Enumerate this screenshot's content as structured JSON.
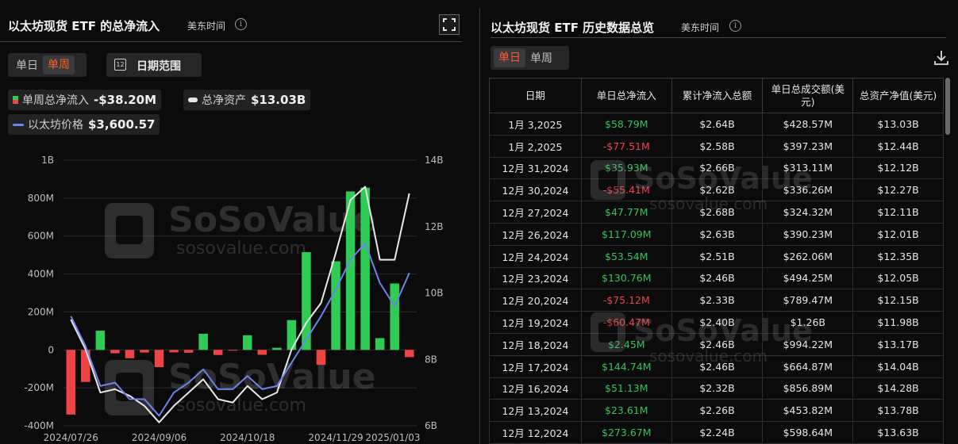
{
  "left_panel": {
    "title": "以太坊现货 ETF 的总净流入",
    "timezone": "美东时间",
    "tabs": [
      "单日",
      "单周"
    ],
    "active_tab": "单周",
    "date_range_label": "日期范围",
    "legend": {
      "net_inflow": {
        "label": "单周总净流入",
        "value": "-$38.20M"
      },
      "total_assets": {
        "label": "总净资产",
        "value": "$13.03B"
      },
      "eth_price": {
        "label": "以太坊价格",
        "value": "$3,600.57"
      }
    },
    "watermark": {
      "brand": "SoSoValue",
      "url": "sosovalue.com"
    }
  },
  "chart_data": {
    "type": "bar",
    "title": "以太坊现货 ETF 的总净流入",
    "x_tick_labels": [
      "2024/07/26",
      "2024/09/06",
      "2024/10/18",
      "2024/11/29",
      "2025/01/03"
    ],
    "y_left": {
      "ticks": [
        "-400M",
        "-200M",
        "0",
        "200M",
        "400M",
        "600M",
        "800M",
        "1B"
      ],
      "range": [
        -400,
        1000
      ],
      "unit": "M"
    },
    "y_right": {
      "ticks": [
        "6B",
        "8B",
        "10B",
        "12B",
        "14B"
      ],
      "range": [
        6,
        14
      ],
      "unit": "B"
    },
    "colors": {
      "positive": "#2ecc55",
      "negative": "#ef4444",
      "assets_line": "#e8e8e8",
      "price_line": "#6c84e6"
    },
    "series": [
      {
        "name": "单周总净流入",
        "type": "bar",
        "axis": "left",
        "values": [
          -341,
          -169,
          101,
          -18,
          -44,
          -14,
          -91,
          -13,
          -15,
          85,
          -27,
          -4,
          77,
          -26,
          11,
          157,
          515,
          -79,
          467,
          835,
          855,
          62,
          350,
          -38
        ]
      },
      {
        "name": "总净资产",
        "type": "line",
        "axis": "right",
        "values": [
          9.2,
          8.3,
          7.0,
          7.1,
          6.9,
          6.6,
          6.1,
          6.6,
          7.0,
          7.4,
          6.8,
          6.7,
          7.2,
          6.8,
          7.0,
          8.3,
          9.1,
          9.7,
          11.2,
          12.8,
          13.2,
          11.0,
          11.0,
          13.0
        ]
      },
      {
        "name": "以太坊价格",
        "type": "line",
        "axis": "right",
        "values": [
          9.3,
          8.4,
          7.2,
          7.3,
          6.8,
          6.8,
          6.3,
          7.0,
          7.3,
          7.7,
          7.1,
          7.1,
          7.5,
          7.1,
          7.2,
          7.9,
          8.6,
          9.3,
          10.1,
          11.0,
          11.5,
          10.3,
          9.6,
          10.6
        ]
      }
    ],
    "grid": true,
    "legend_position": "top-left"
  },
  "right_panel": {
    "title": "以太坊现货 ETF 历史数据总览",
    "timezone": "美东时间",
    "tabs": [
      "单日",
      "单周"
    ],
    "active_tab": "单日",
    "columns": [
      "日期",
      "单日总净流入",
      "累计净流入总额",
      "单日总成交额(美元)",
      "总资产净值(美元)"
    ],
    "rows": [
      {
        "date": "1月 3,2025",
        "flow": "$58.79M",
        "flow_sign": "pos",
        "cum": "$2.64B",
        "vol": "$428.57M",
        "nav": "$13.03B"
      },
      {
        "date": "1月 2,2025",
        "flow": "-$77.51M",
        "flow_sign": "neg",
        "cum": "$2.58B",
        "vol": "$397.23M",
        "nav": "$12.44B"
      },
      {
        "date": "12月 31,2024",
        "flow": "$35.93M",
        "flow_sign": "pos",
        "cum": "$2.66B",
        "vol": "$313.11M",
        "nav": "$12.12B"
      },
      {
        "date": "12月 30,2024",
        "flow": "-$55.41M",
        "flow_sign": "neg",
        "cum": "$2.62B",
        "vol": "$336.26M",
        "nav": "$12.27B"
      },
      {
        "date": "12月 27,2024",
        "flow": "$47.77M",
        "flow_sign": "pos",
        "cum": "$2.68B",
        "vol": "$324.32M",
        "nav": "$12.11B"
      },
      {
        "date": "12月 26,2024",
        "flow": "$117.09M",
        "flow_sign": "pos",
        "cum": "$2.63B",
        "vol": "$390.23M",
        "nav": "$12.01B"
      },
      {
        "date": "12月 24,2024",
        "flow": "$53.54M",
        "flow_sign": "pos",
        "cum": "$2.51B",
        "vol": "$262.06M",
        "nav": "$12.35B"
      },
      {
        "date": "12月 23,2024",
        "flow": "$130.76M",
        "flow_sign": "pos",
        "cum": "$2.46B",
        "vol": "$494.25M",
        "nav": "$12.05B"
      },
      {
        "date": "12月 20,2024",
        "flow": "-$75.12M",
        "flow_sign": "neg",
        "cum": "$2.33B",
        "vol": "$789.47M",
        "nav": "$12.15B"
      },
      {
        "date": "12月 19,2024",
        "flow": "-$60.47M",
        "flow_sign": "neg",
        "cum": "$2.40B",
        "vol": "$1.26B",
        "nav": "$11.98B"
      },
      {
        "date": "12月 18,2024",
        "flow": "$2.45M",
        "flow_sign": "pos",
        "cum": "$2.46B",
        "vol": "$994.22M",
        "nav": "$13.17B"
      },
      {
        "date": "12月 17,2024",
        "flow": "$144.74M",
        "flow_sign": "pos",
        "cum": "$2.46B",
        "vol": "$664.87M",
        "nav": "$14.04B"
      },
      {
        "date": "12月 16,2024",
        "flow": "$51.13M",
        "flow_sign": "pos",
        "cum": "$2.32B",
        "vol": "$856.89M",
        "nav": "$14.28B"
      },
      {
        "date": "12月 13,2024",
        "flow": "$23.61M",
        "flow_sign": "pos",
        "cum": "$2.26B",
        "vol": "$453.82M",
        "nav": "$13.78B"
      },
      {
        "date": "12月 12,2024",
        "flow": "$273.67M",
        "flow_sign": "pos",
        "cum": "$2.24B",
        "vol": "$598.64M",
        "nav": "$13.63B"
      }
    ],
    "watermark": {
      "brand": "SoSoValue",
      "url": "sosovalue.com"
    }
  }
}
